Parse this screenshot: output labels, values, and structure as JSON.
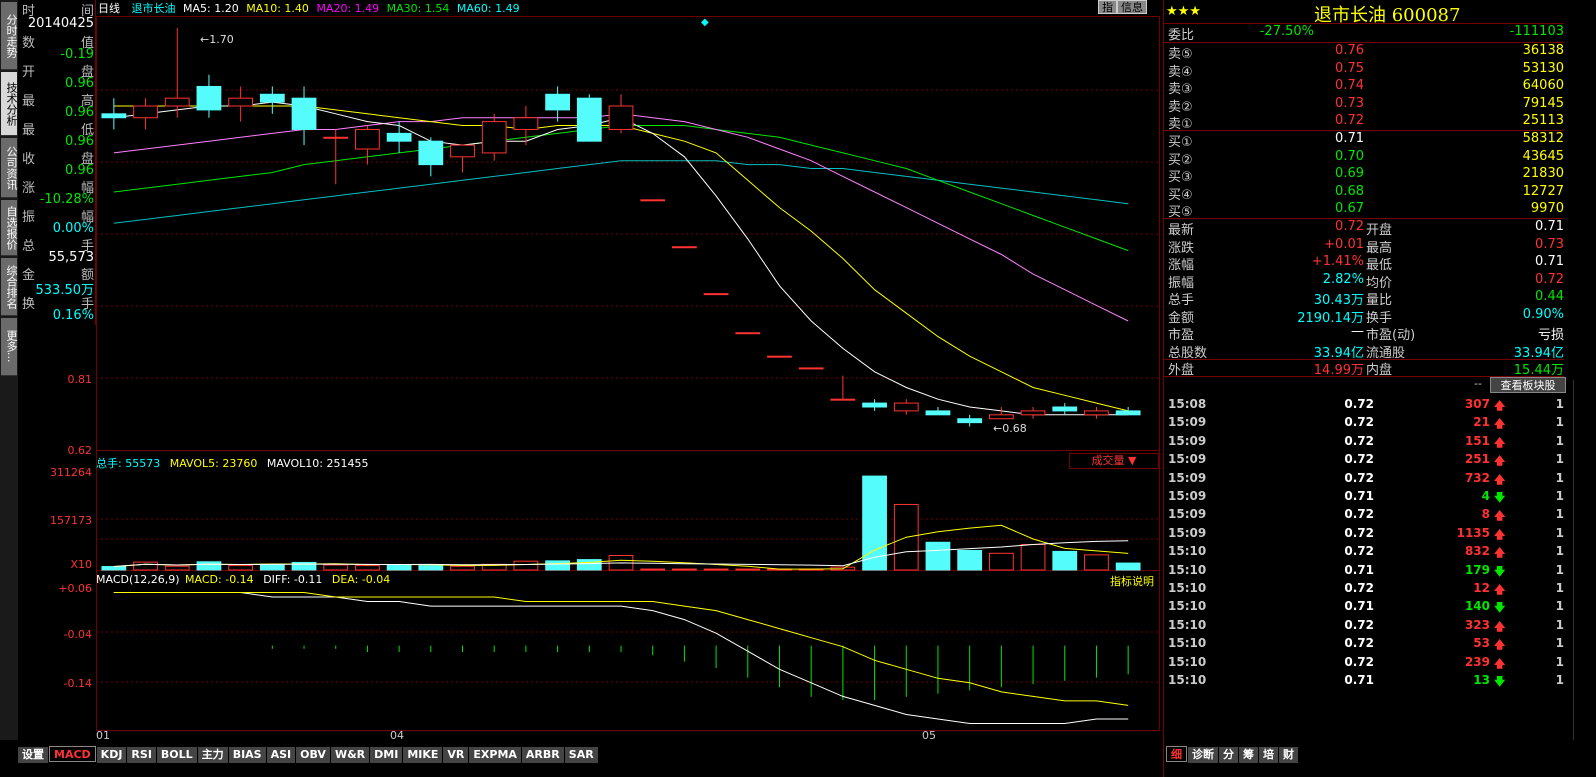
{
  "left_tabs": [
    "分时走势",
    "技术分析",
    "公司资讯",
    "自选报价",
    "综合排名",
    "更多..."
  ],
  "info": {
    "time_label": "时",
    "time_label2": "间",
    "date": "20140425",
    "rows": [
      {
        "l": "数",
        "r": "值",
        "v": "-0.19",
        "c": "grn"
      },
      {
        "l": "开",
        "r": "盘",
        "v": "0.96",
        "c": "grn"
      },
      {
        "l": "最",
        "r": "高",
        "v": "0.96",
        "c": "grn"
      },
      {
        "l": "最",
        "r": "低",
        "v": "0.96",
        "c": "grn"
      },
      {
        "l": "收",
        "r": "盘",
        "v": "0.96",
        "c": "grn"
      },
      {
        "l": "涨",
        "r": "幅",
        "v": "-10.28%",
        "c": "grn"
      },
      {
        "l": "振",
        "r": "幅",
        "v": "0.00%",
        "c": "cyn"
      },
      {
        "l": "总",
        "r": "手",
        "v": "55,573",
        "c": "wht"
      },
      {
        "l": "金",
        "r": "额",
        "v": "533.50万",
        "c": "cyn"
      },
      {
        "l": "换",
        "r": "手",
        "v": "0.16%",
        "c": "cyn"
      }
    ]
  },
  "header": {
    "period": "日线",
    "name": "退市长油",
    "ma5": "MA5: 1.20",
    "ma10": "MA10: 1.40",
    "ma20": "MA20: 1.49",
    "ma30": "MA30: 1.54",
    "ma60": "MA60: 1.49",
    "btn1": "指",
    "btn2": "信息"
  },
  "price_axis": [
    "0.81",
    "0.62"
  ],
  "hi_label": "1.70",
  "lo_label": "0.68",
  "vol_header": {
    "total": "总手: 55573",
    "mavol5": "MAVOL5: 23760",
    "mavol10": "MAVOL10: 251455",
    "dropdown": "成交量"
  },
  "vol_axis": [
    "311264",
    "157173",
    "X10"
  ],
  "macd_header": {
    "title": "MACD(12,26,9)",
    "macd": "MACD: -0.14",
    "diff": "DIFF: -0.11",
    "dea": "DEA: -0.04",
    "help": "指标说明"
  },
  "macd_axis": [
    "+0.06",
    "-0.04",
    "-0.14"
  ],
  "x_axis": [
    "01",
    "04",
    "05"
  ],
  "bottom_tabs": [
    "设置",
    "MACD",
    "KDJ",
    "RSI",
    "BOLL",
    "主力",
    "BIAS",
    "ASI",
    "OBV",
    "W&R",
    "DMI",
    "MIKE",
    "VR",
    "EXPMA",
    "ARBR",
    "SAR"
  ],
  "stock": {
    "stars": "★★★",
    "name": "退市长油",
    "code": "600087"
  },
  "order_book": {
    "weibi": {
      "label": "委比",
      "pct": "-27.50%",
      "diff": "-111103"
    },
    "sells": [
      {
        "label": "卖⑤",
        "price": "0.76",
        "vol": "36138"
      },
      {
        "label": "卖④",
        "price": "0.75",
        "vol": "53130"
      },
      {
        "label": "卖③",
        "price": "0.74",
        "vol": "64060"
      },
      {
        "label": "卖②",
        "price": "0.73",
        "vol": "79145"
      },
      {
        "label": "卖①",
        "price": "0.72",
        "vol": "25113"
      }
    ],
    "buys": [
      {
        "label": "买①",
        "price": "0.71",
        "vol": "58312"
      },
      {
        "label": "买②",
        "price": "0.70",
        "vol": "43645"
      },
      {
        "label": "买③",
        "price": "0.69",
        "vol": "21830"
      },
      {
        "label": "买④",
        "price": "0.68",
        "vol": "12727"
      },
      {
        "label": "买⑤",
        "price": "0.67",
        "vol": "9970"
      }
    ]
  },
  "quote": [
    {
      "l1": "最新",
      "v1": "0.72",
      "c1": "red",
      "l2": "开盘",
      "v2": "0.71",
      "c2": "wht"
    },
    {
      "l1": "涨跌",
      "v1": "+0.01",
      "c1": "red",
      "l2": "最高",
      "v2": "0.73",
      "c2": "red"
    },
    {
      "l1": "涨幅",
      "v1": "+1.41%",
      "c1": "red",
      "l2": "最低",
      "v2": "0.71",
      "c2": "wht"
    },
    {
      "l1": "振幅",
      "v1": "2.82%",
      "c1": "cyn",
      "l2": "均价",
      "v2": "0.72",
      "c2": "red"
    },
    {
      "l1": "总手",
      "v1": "30.43万",
      "c1": "cyn",
      "l2": "量比",
      "v2": "0.44",
      "c2": "grn"
    },
    {
      "l1": "金额",
      "v1": "2190.14万",
      "c1": "cyn",
      "l2": "换手",
      "v2": "0.90%",
      "c2": "cyn"
    },
    {
      "l1": "市盈",
      "v1": "—",
      "c1": "wht",
      "l2": "市盈(动)",
      "v2": "亏损",
      "c2": "wht"
    },
    {
      "l1": "总股数",
      "v1": "33.94亿",
      "c1": "cyn",
      "l2": "流通股",
      "v2": "33.94亿",
      "c2": "cyn"
    },
    {
      "l1": "外盘",
      "v1": "14.99万",
      "c1": "red",
      "l2": "内盘",
      "v2": "15.44万",
      "c2": "grn"
    }
  ],
  "sector_btn": "查看板块股",
  "ticks": [
    {
      "t": "15:08",
      "p": "0.72",
      "v": "307",
      "d": "up",
      "n": "1"
    },
    {
      "t": "15:09",
      "p": "0.72",
      "v": "21",
      "d": "up",
      "n": "1"
    },
    {
      "t": "15:09",
      "p": "0.72",
      "v": "151",
      "d": "up",
      "n": "1"
    },
    {
      "t": "15:09",
      "p": "0.72",
      "v": "251",
      "d": "up",
      "n": "1"
    },
    {
      "t": "15:09",
      "p": "0.72",
      "v": "732",
      "d": "up",
      "n": "1"
    },
    {
      "t": "15:09",
      "p": "0.71",
      "v": "4",
      "d": "down",
      "n": "1"
    },
    {
      "t": "15:09",
      "p": "0.72",
      "v": "8",
      "d": "up",
      "n": "1"
    },
    {
      "t": "15:09",
      "p": "0.72",
      "v": "1135",
      "d": "up",
      "n": "1"
    },
    {
      "t": "15:10",
      "p": "0.72",
      "v": "832",
      "d": "up",
      "n": "1"
    },
    {
      "t": "15:10",
      "p": "0.71",
      "v": "179",
      "d": "down",
      "n": "1"
    },
    {
      "t": "15:10",
      "p": "0.72",
      "v": "12",
      "d": "up",
      "n": "1"
    },
    {
      "t": "15:10",
      "p": "0.71",
      "v": "140",
      "d": "down",
      "n": "1"
    },
    {
      "t": "15:10",
      "p": "0.72",
      "v": "323",
      "d": "up",
      "n": "1"
    },
    {
      "t": "15:10",
      "p": "0.72",
      "v": "53",
      "d": "up",
      "n": "1"
    },
    {
      "t": "15:10",
      "p": "0.72",
      "v": "239",
      "d": "up",
      "n": "1"
    },
    {
      "t": "15:10",
      "p": "0.71",
      "v": "13",
      "d": "down",
      "n": "1"
    }
  ],
  "right_tabs": [
    "细",
    "诊断",
    "分",
    "筹",
    "培",
    "财"
  ],
  "chart_data": {
    "type": "candlestick",
    "title": "退市长油 日线",
    "ohlc": [
      [
        1.48,
        1.52,
        1.44,
        1.47
      ],
      [
        1.47,
        1.52,
        1.44,
        1.5
      ],
      [
        1.5,
        1.7,
        1.47,
        1.52
      ],
      [
        1.55,
        1.58,
        1.47,
        1.49
      ],
      [
        1.5,
        1.55,
        1.46,
        1.52
      ],
      [
        1.53,
        1.55,
        1.48,
        1.51
      ],
      [
        1.52,
        1.55,
        1.4,
        1.44
      ],
      [
        1.42,
        1.44,
        1.3,
        1.42
      ],
      [
        1.39,
        1.45,
        1.35,
        1.44
      ],
      [
        1.43,
        1.46,
        1.38,
        1.41
      ],
      [
        1.41,
        1.42,
        1.32,
        1.35
      ],
      [
        1.37,
        1.4,
        1.33,
        1.4
      ],
      [
        1.38,
        1.48,
        1.36,
        1.46
      ],
      [
        1.44,
        1.5,
        1.4,
        1.47
      ],
      [
        1.53,
        1.55,
        1.46,
        1.49
      ],
      [
        1.52,
        1.53,
        1.41,
        1.41
      ],
      [
        1.44,
        1.53,
        1.43,
        1.5
      ],
      [
        1.26,
        1.26,
        1.26,
        1.26
      ],
      [
        1.14,
        1.14,
        1.14,
        1.14
      ],
      [
        1.02,
        1.02,
        1.02,
        1.02
      ],
      [
        0.92,
        0.92,
        0.92,
        0.92
      ],
      [
        0.86,
        0.86,
        0.86,
        0.86
      ],
      [
        0.83,
        0.83,
        0.83,
        0.83
      ],
      [
        0.75,
        0.81,
        0.75,
        0.75
      ],
      [
        0.74,
        0.75,
        0.72,
        0.73
      ],
      [
        0.72,
        0.75,
        0.71,
        0.74
      ],
      [
        0.72,
        0.73,
        0.71,
        0.71
      ],
      [
        0.7,
        0.71,
        0.68,
        0.69
      ],
      [
        0.7,
        0.73,
        0.7,
        0.71
      ],
      [
        0.71,
        0.73,
        0.7,
        0.72
      ],
      [
        0.73,
        0.74,
        0.71,
        0.72
      ],
      [
        0.71,
        0.73,
        0.7,
        0.72
      ],
      [
        0.72,
        0.73,
        0.71,
        0.71
      ]
    ],
    "volume": [
      1.1,
      2.5,
      1.2,
      2.6,
      1.4,
      1.8,
      2.4,
      1.6,
      1.4,
      1.5,
      1.4,
      1.2,
      1.8,
      2.8,
      2.9,
      3.3,
      4.6,
      0.3,
      0.3,
      0.3,
      0.3,
      0.3,
      0.3,
      0.9,
      29.8,
      20.8,
      8.8,
      6.2,
      5.3,
      8.1,
      5.9,
      4.8,
      2.2
    ],
    "ma5": [
      1.47,
      1.48,
      1.49,
      1.5,
      1.5,
      1.51,
      1.5,
      1.48,
      1.46,
      1.45,
      1.41,
      1.4,
      1.41,
      1.41,
      1.44,
      1.45,
      1.47,
      1.43,
      1.37,
      1.27,
      1.16,
      1.04,
      0.95,
      0.88,
      0.82,
      0.78,
      0.75,
      0.73,
      0.72,
      0.71,
      0.71,
      0.71,
      0.71
    ],
    "ma10": [
      1.5,
      1.5,
      1.5,
      1.5,
      1.5,
      1.5,
      1.5,
      1.49,
      1.48,
      1.47,
      1.46,
      1.45,
      1.45,
      1.44,
      1.45,
      1.45,
      1.45,
      1.43,
      1.41,
      1.38,
      1.31,
      1.24,
      1.18,
      1.11,
      1.03,
      0.97,
      0.91,
      0.86,
      0.82,
      0.78,
      0.76,
      0.74,
      0.72
    ],
    "ma20": [
      1.38,
      1.39,
      1.4,
      1.41,
      1.42,
      1.43,
      1.44,
      1.44,
      1.45,
      1.46,
      1.46,
      1.47,
      1.47,
      1.47,
      1.47,
      1.47,
      1.48,
      1.47,
      1.46,
      1.44,
      1.42,
      1.39,
      1.36,
      1.32,
      1.28,
      1.24,
      1.2,
      1.16,
      1.12,
      1.07,
      1.03,
      0.99,
      0.95
    ],
    "ma30": [
      1.28,
      1.29,
      1.3,
      1.31,
      1.32,
      1.33,
      1.35,
      1.36,
      1.37,
      1.38,
      1.39,
      1.4,
      1.41,
      1.42,
      1.43,
      1.44,
      1.45,
      1.45,
      1.45,
      1.44,
      1.43,
      1.42,
      1.4,
      1.38,
      1.36,
      1.34,
      1.31,
      1.28,
      1.25,
      1.22,
      1.19,
      1.16,
      1.13
    ],
    "ma60": [
      1.2,
      1.21,
      1.22,
      1.23,
      1.24,
      1.25,
      1.26,
      1.27,
      1.28,
      1.29,
      1.3,
      1.31,
      1.32,
      1.33,
      1.34,
      1.35,
      1.36,
      1.36,
      1.36,
      1.36,
      1.35,
      1.35,
      1.34,
      1.34,
      1.33,
      1.32,
      1.31,
      1.3,
      1.29,
      1.28,
      1.27,
      1.26,
      1.25
    ],
    "macd_hist": [
      0.0,
      0.0,
      0.0,
      0.0,
      0.0,
      -0.01,
      -0.01,
      -0.01,
      -0.02,
      -0.02,
      -0.02,
      -0.02,
      -0.02,
      -0.02,
      -0.02,
      -0.02,
      -0.02,
      -0.03,
      -0.05,
      -0.07,
      -0.1,
      -0.13,
      -0.16,
      -0.17,
      -0.17,
      -0.16,
      -0.15,
      -0.14,
      -0.13,
      -0.12,
      -0.11,
      -0.1,
      -0.09
    ],
    "diff": [
      0.06,
      0.06,
      0.06,
      0.06,
      0.06,
      0.05,
      0.05,
      0.05,
      0.04,
      0.04,
      0.03,
      0.03,
      0.03,
      0.03,
      0.03,
      0.03,
      0.03,
      0.02,
      0.0,
      -0.03,
      -0.07,
      -0.11,
      -0.14,
      -0.17,
      -0.19,
      -0.21,
      -0.22,
      -0.23,
      -0.23,
      -0.23,
      -0.23,
      -0.22,
      -0.22
    ],
    "dea": [
      0.06,
      0.06,
      0.06,
      0.06,
      0.06,
      0.06,
      0.06,
      0.05,
      0.05,
      0.05,
      0.05,
      0.05,
      0.05,
      0.04,
      0.04,
      0.04,
      0.04,
      0.04,
      0.03,
      0.02,
      0.0,
      -0.02,
      -0.04,
      -0.06,
      -0.09,
      -0.11,
      -0.13,
      -0.14,
      -0.16,
      -0.17,
      -0.18,
      -0.18,
      -0.19
    ]
  },
  "colors": {
    "up": "#ff3232",
    "down": "#54fcfc",
    "ma5": "#ffffff",
    "ma10": "#ffff00",
    "ma20": "#ff80ff",
    "ma30": "#00e600",
    "ma60": "#00c0c0",
    "grid": "#700000"
  }
}
